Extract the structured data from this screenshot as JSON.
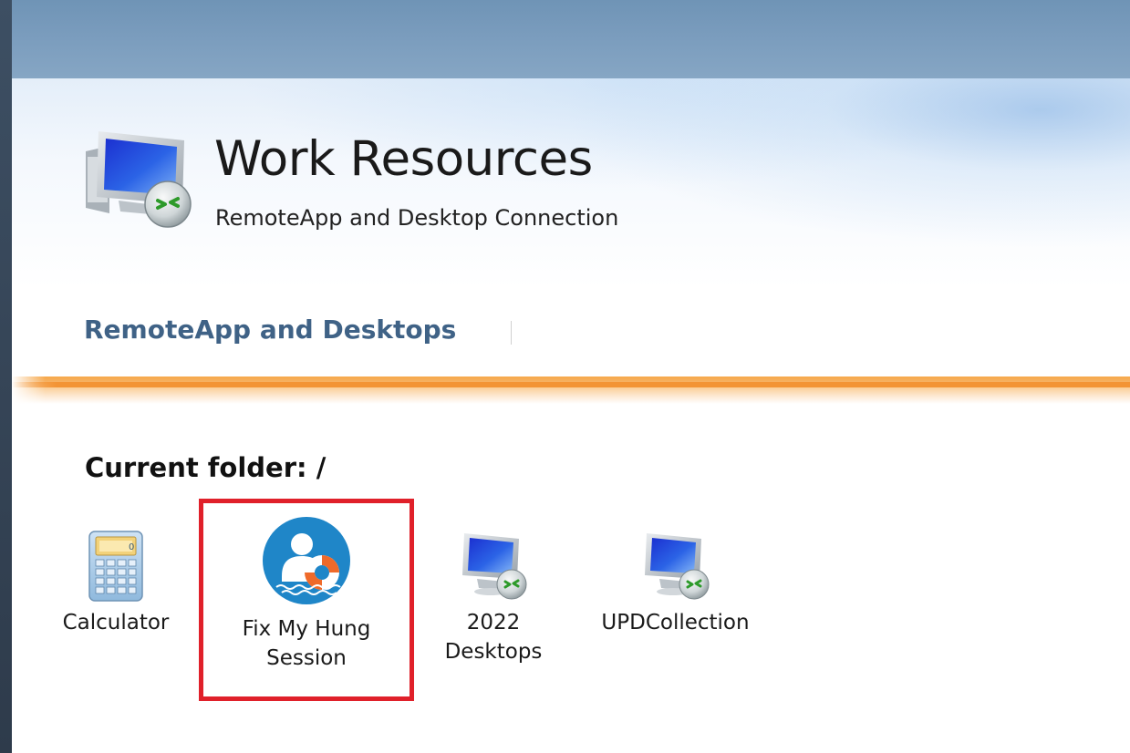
{
  "header": {
    "title": "Work Resources",
    "subtitle": "RemoteApp and Desktop Connection"
  },
  "nav": {
    "tab_label": "RemoteApp and Desktops"
  },
  "folder": {
    "label": "Current folder: /"
  },
  "apps": [
    {
      "label": "Calculator",
      "icon": "calculator-icon"
    },
    {
      "label": "Fix My Hung Session",
      "icon": "lifebuoy-support-icon"
    },
    {
      "label": "2022 Desktops",
      "icon": "remote-desktop-icon"
    },
    {
      "label": "UPDCollection",
      "icon": "remote-desktop-icon"
    }
  ],
  "colors": {
    "nav_tab": "#3f6286",
    "accent_orange": "#f39435",
    "highlight_box": "#e0202a",
    "titlebar": "#7a9cbd"
  }
}
